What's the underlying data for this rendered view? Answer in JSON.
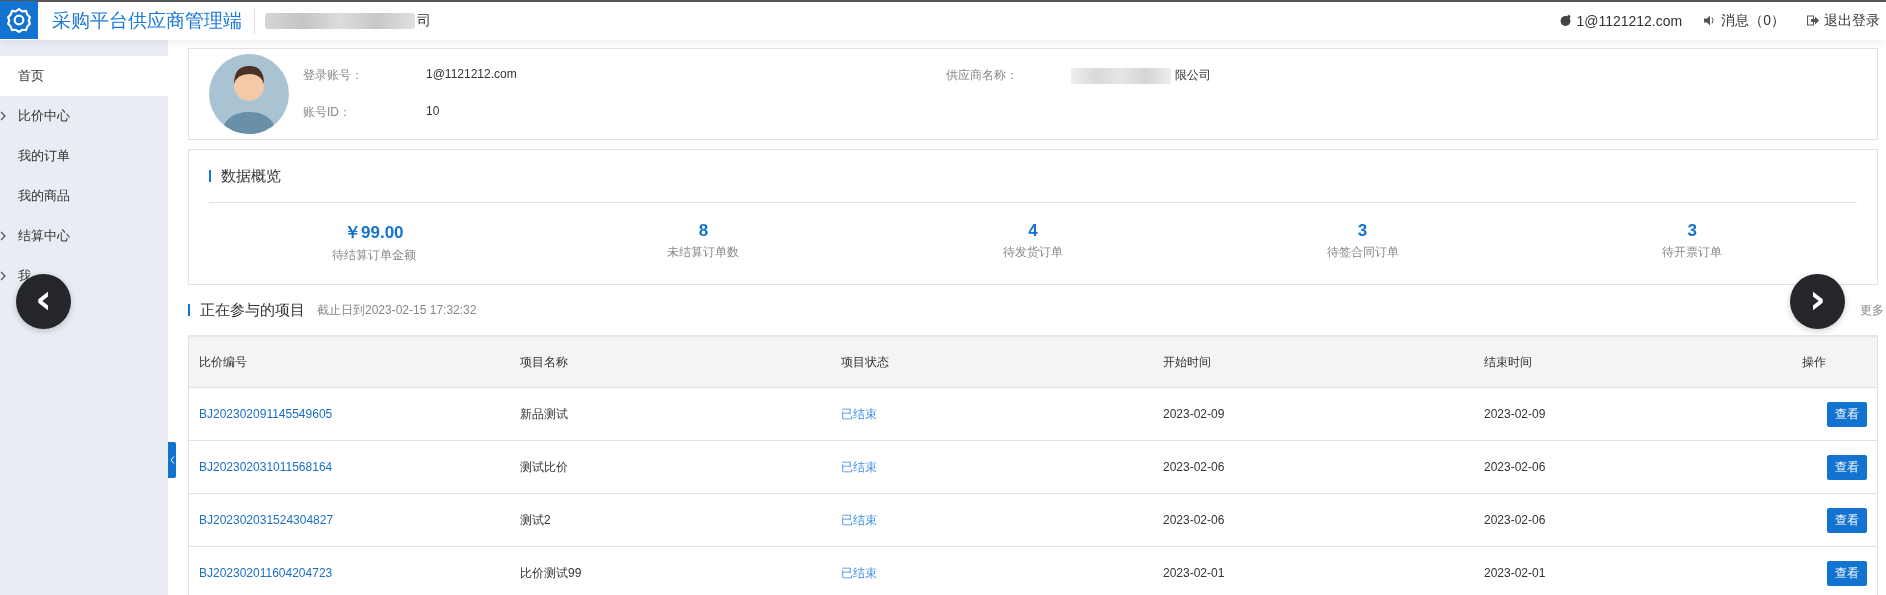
{
  "header": {
    "title": "采购平台供应商管理端",
    "company": {
      "visible_text": "司",
      "redacted": true
    },
    "user": "1@1121212.com",
    "messages": "消息（0）",
    "logout": "退出登录"
  },
  "sidebar": {
    "items": [
      {
        "label": "首页",
        "selected": true,
        "has_children": false
      },
      {
        "label": "比价中心",
        "selected": false,
        "has_children": true
      },
      {
        "label": "我的订单",
        "selected": false,
        "has_children": false
      },
      {
        "label": "我的商品",
        "selected": false,
        "has_children": false
      },
      {
        "label": "结算中心",
        "selected": false,
        "has_children": true
      },
      {
        "label": "我",
        "selected": false,
        "has_children": true
      }
    ]
  },
  "profile": {
    "fields": [
      {
        "label": "登录账号：",
        "value": "1@1121212.com"
      },
      {
        "label": "账号ID：",
        "value": "10"
      }
    ],
    "supplier": {
      "label": "供应商名称：",
      "value": "限公司",
      "redacted": true
    }
  },
  "overview": {
    "title": "数据概览",
    "stats": [
      {
        "value": "￥99.00",
        "label": "待结算订单金额"
      },
      {
        "value": "8",
        "label": "未结算订单数"
      },
      {
        "value": "4",
        "label": "待发货订单"
      },
      {
        "value": "3",
        "label": "待签合同订单"
      },
      {
        "value": "3",
        "label": "待开票订单"
      }
    ]
  },
  "projects": {
    "title": "正在参与的项目",
    "subtitle": "截止日到2023-02-15 17:32:32",
    "more": "更多",
    "columns": [
      "比价编号",
      "项目名称",
      "项目状态",
      "开始时间",
      "结束时间",
      "操作"
    ],
    "rows": [
      {
        "code": "BJ202302091145549605",
        "name": "新品测试",
        "status": "已结束",
        "start": "2023-02-09",
        "end": "2023-02-09",
        "action": "查看"
      },
      {
        "code": "BJ202302031011568164",
        "name": "测试比价",
        "status": "已结束",
        "start": "2023-02-06",
        "end": "2023-02-06",
        "action": "查看"
      },
      {
        "code": "BJ202302031524304827",
        "name": "测试2",
        "status": "已结束",
        "start": "2023-02-06",
        "end": "2023-02-06",
        "action": "查看"
      },
      {
        "code": "BJ202302011604204723",
        "name": "比价测试99",
        "status": "已结束",
        "start": "2023-02-01",
        "end": "2023-02-01",
        "action": "查看"
      }
    ]
  },
  "carousel": {
    "prev": "‹",
    "next": "›"
  }
}
